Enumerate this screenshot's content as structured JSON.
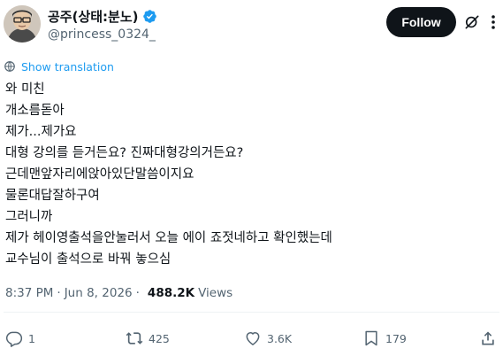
{
  "author": {
    "display_name": "공주(상태:분노)",
    "handle": "@princess_0324_",
    "verified_icon": "verified-badge-icon"
  },
  "header": {
    "follow_label": "Follow",
    "grok_icon": "grok-icon",
    "more_icon": "more-vertical-icon"
  },
  "translation": {
    "label": "Show translation",
    "icon": "globe-icon"
  },
  "post": {
    "lines": [
      "와 미친",
      "개소름돋아",
      "제가...제가요",
      "대형 강의를 듣거든요? 진짜대형강의거든요?",
      "근데맨앞자리에앉아있단말씀이지요",
      "물론대답잘하구여",
      "그러니까",
      "제가 헤이영출석을안눌러서 오늘 에이 죠젓네하고 확인했는데",
      "교수님이 출석으로 바꿔 놓으심"
    ]
  },
  "meta": {
    "time": "8:37 PM",
    "separator": "·",
    "date": "Jun 8, 2026",
    "views_count": "488.2K",
    "views_label": "Views"
  },
  "actions": {
    "reply_count": "1",
    "repost_count": "425",
    "like_count": "3.6K",
    "bookmark_count": "179"
  },
  "colors": {
    "accent": "#1d9bf0",
    "text": "#0f1419",
    "muted": "#536471",
    "follow_bg": "#0f1419"
  }
}
